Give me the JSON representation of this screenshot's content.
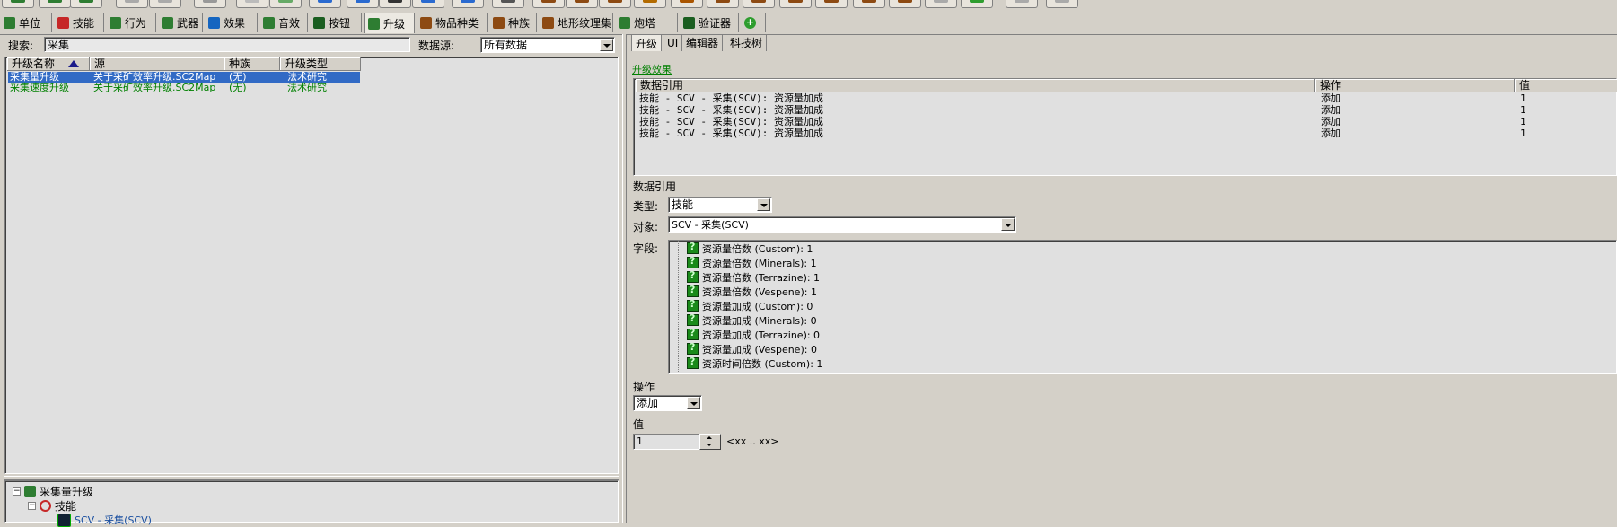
{
  "main_tabs": [
    {
      "label": "单位",
      "icon": "unit-icon",
      "color": "#2e7d32"
    },
    {
      "label": "技能",
      "icon": "ability-icon",
      "color": "#c62828"
    },
    {
      "label": "行为",
      "icon": "behavior-icon",
      "color": "#2e7d32"
    },
    {
      "label": "武器",
      "icon": "weapon-icon",
      "color": "#2e7d32"
    },
    {
      "label": "效果",
      "icon": "effect-icon",
      "color": "#1565c0"
    },
    {
      "label": "音效",
      "icon": "sound-icon",
      "color": "#2e7d32"
    },
    {
      "label": "按钮",
      "icon": "button-icon",
      "color": "#1b5e20"
    },
    {
      "label": "升级",
      "icon": "upgrade-icon",
      "color": "#2e7d32"
    },
    {
      "label": "物品种类",
      "icon": "item-class-icon",
      "color": "#8d4a12"
    },
    {
      "label": "种族",
      "icon": "race-icon",
      "color": "#8d4a12"
    },
    {
      "label": "地形纹理集",
      "icon": "terrain-texture-icon",
      "color": "#8d4a12"
    },
    {
      "label": "炮塔",
      "icon": "turret-icon",
      "color": "#2e7d32"
    },
    {
      "label": "验证器",
      "icon": "validator-icon",
      "color": "#1b5e20"
    },
    {
      "label": "",
      "icon": "add-icon",
      "color": "#2e9d2e"
    }
  ],
  "left": {
    "search_label": "搜索:",
    "search_value": "采集",
    "source_label": "数据源:",
    "source_value": "所有数据",
    "columns": [
      "升级名称",
      "源",
      "种族",
      "升级类型"
    ],
    "rows": [
      {
        "name": "采集量升级",
        "source": "关于采矿效率升级.SC2Map",
        "race": "(无)",
        "type": "法术研究",
        "selected": true
      },
      {
        "name": "采集速度升级",
        "source": "关于采矿效率升级.SC2Map",
        "race": "(无)",
        "type": "法术研究",
        "selected": false
      }
    ],
    "tree": {
      "root": "采集量升级",
      "child": "技能",
      "leaf": "SCV - 采集(SCV)"
    }
  },
  "right": {
    "tabs": [
      "升级",
      "UI",
      "编辑器",
      "科技树"
    ],
    "effects_link": "升级效果",
    "table_columns": [
      "数据引用",
      "操作",
      "值"
    ],
    "table_rows": [
      {
        "ref": "技能 - SCV - 采集(SCV): 资源量加成",
        "op": "添加",
        "val": "1"
      },
      {
        "ref": "技能 - SCV - 采集(SCV): 资源量加成",
        "op": "添加",
        "val": "1"
      },
      {
        "ref": "技能 - SCV - 采集(SCV): 资源量加成",
        "op": "添加",
        "val": "1"
      },
      {
        "ref": "技能 - SCV - 采集(SCV): 资源量加成",
        "op": "添加",
        "val": "1"
      }
    ],
    "data_ref_heading": "数据引用",
    "type_label": "类型:",
    "type_value": "技能",
    "target_label": "对象:",
    "target_value": "SCV - 采集(SCV)",
    "fields_label": "字段:",
    "fields": [
      "资源量倍数 (Custom): 1",
      "资源量倍数 (Minerals): 1",
      "资源量倍数 (Terrazine): 1",
      "资源量倍数 (Vespene): 1",
      "资源量加成 (Custom): 0",
      "资源量加成 (Minerals): 0",
      "资源量加成 (Terrazine): 0",
      "资源量加成 (Vespene): 0",
      "资源时间倍数 (Custom): 1"
    ],
    "operation_label": "操作",
    "operation_value": "添加",
    "value_label": "值",
    "value_value": "1",
    "range_hint": "<xx .. xx>"
  }
}
